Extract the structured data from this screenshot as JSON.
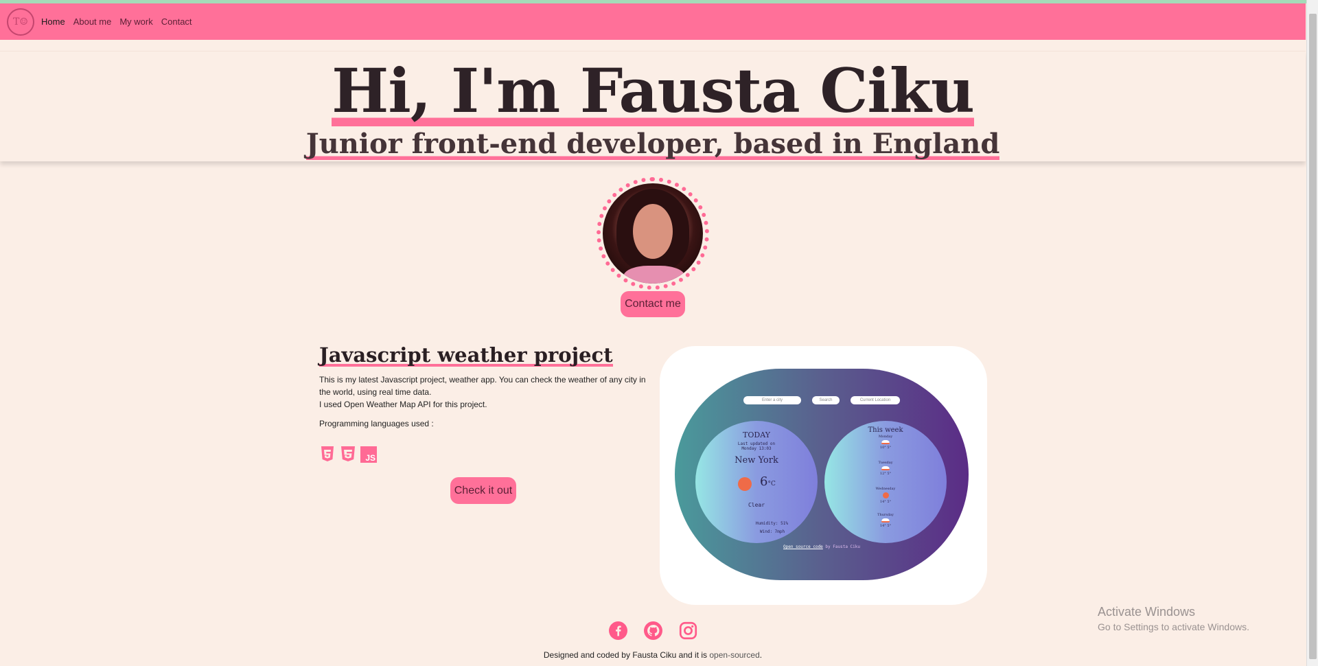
{
  "nav": {
    "logo_text": "T☺",
    "links": [
      "Home",
      "About me",
      "My work",
      "Contact"
    ]
  },
  "hero": {
    "title": "Hi, I'm Fausta Ciku",
    "subtitle": "Junior front-end developer, based in England"
  },
  "contact_button": "Contact me",
  "project": {
    "title": "Javascript weather project",
    "desc_line1": "This is my latest Javascript project, weather app. You can check the weather of any city in the world, using real time data.",
    "desc_line2": "I used Open Weather Map API for this project.",
    "langs_label": "Programming languages used :",
    "langs": [
      "html5-icon",
      "css3-icon",
      "js-icon"
    ],
    "js_label": "JS",
    "check_button": "Check it out"
  },
  "preview": {
    "city_placeholder": "Enter a city",
    "search_label": "Search",
    "current_location_label": "Current Location",
    "today": "TODAY",
    "last_updated": "Last updated on",
    "updated_time": "Monday 13:03",
    "city": "New York",
    "temp": "6",
    "unit": "°C",
    "condition": "Clear",
    "humidity": "Humidity: 51%",
    "wind": "Wind: 7mph",
    "week_title": "This week",
    "days": [
      {
        "name": "Monday",
        "temps": "10° 5°"
      },
      {
        "name": "Tuesday",
        "temps": "12° 5°"
      },
      {
        "name": "Wednesday",
        "temps": "14° 5°"
      },
      {
        "name": "Thursday",
        "temps": "14° 5°"
      }
    ],
    "footer_link": "Open source code",
    "footer_rest": "by Fausta Ciku"
  },
  "footer": {
    "text_before": "Designed and coded by Fausta Ciku and it is ",
    "link": "open-sourced",
    "text_after": "."
  },
  "watermark": {
    "title": "Activate Windows",
    "subtitle": "Go to Settings to activate Windows."
  },
  "colors": {
    "accent": "#ff7099",
    "background": "#fbeee6",
    "sun": "#ef6b48"
  }
}
